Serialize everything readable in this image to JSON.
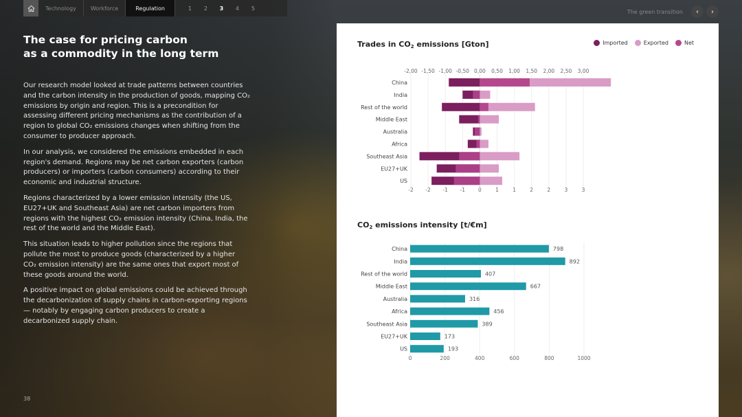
{
  "nav": {
    "items": [
      "Technology",
      "Workforce",
      "Regulation"
    ],
    "active_item": "Regulation",
    "pages": [
      "1",
      "2",
      "3",
      "4",
      "5"
    ],
    "active_page": "3",
    "section_label": "The green transition"
  },
  "left": {
    "title": "The case for pricing carbon\nas a commodity in the long term",
    "paragraphs": [
      "Our research model looked at trade patterns between countries and the carbon intensity in the production of goods, mapping CO₂ emissions by origin and region. This is a precondition for assessing different pricing mechanisms as the contribution of a region to global CO₂ emissions changes when shifting from the consumer to producer approach.",
      "In our analysis, we considered the emissions embedded in each region's demand. Regions may be net carbon exporters (carbon producers) or importers (carbon consumers) according to their economic and industrial structure.",
      "Regions characterized by a lower emission intensity (the US, EU27+UK and Southeast Asia) are net carbon importers from regions with the highest CO₂ emission intensity (China, India, the rest of the world and the Middle East).",
      "This situation leads to higher pollution since the regions that pollute the most to produce goods (characterized by a higher CO₂ emission intensity) are the same ones that export most of these goods around the world.",
      "A positive impact on global emissions could be achieved through the decarbonization of supply chains in carbon-exporting regions — notably by engaging carbon producers to create a decarbonized supply chain."
    ],
    "page_number": "38"
  },
  "chart_data": [
    {
      "type": "bar",
      "orientation": "horizontal-stacked",
      "title": "Trades in CO₂ emissions [Gton]",
      "categories": [
        "China",
        "India",
        "Rest of the world",
        "Middle East",
        "Australia",
        "Africa",
        "Southeast Asia",
        "EU27+UK",
        "US"
      ],
      "series": [
        {
          "name": "Imported",
          "color": "#7b1f5e",
          "values": [
            -0.9,
            -0.5,
            -1.1,
            -0.6,
            -0.2,
            -0.35,
            -1.75,
            -1.25,
            -1.4
          ]
        },
        {
          "name": "Exported",
          "color": "#d99cc6",
          "values": [
            2.35,
            0.3,
            1.35,
            0.55,
            0.05,
            0.25,
            1.15,
            0.55,
            0.65
          ]
        },
        {
          "name": "Net",
          "color": "#b5478f",
          "values": [
            1.45,
            -0.2,
            0.25,
            -0.05,
            -0.15,
            -0.1,
            -0.6,
            -0.7,
            -0.75
          ]
        }
      ],
      "xlim": [
        -2,
        3
      ],
      "top_ticks": [
        "-2,00",
        "-1,50",
        "-1,00",
        "-0,50",
        "0,00",
        "0,50",
        "1,00",
        "1,50",
        "2,00",
        "2,50",
        "3,00"
      ],
      "bottom_ticks": [
        "-2",
        "-2",
        "-1",
        "-1",
        "0",
        "1",
        "1",
        "2",
        "2",
        "3",
        "3"
      ],
      "legend_position": "top-right"
    },
    {
      "type": "bar",
      "orientation": "horizontal",
      "title": "CO₂ emissions intensity [t/€m]",
      "categories": [
        "China",
        "India",
        "Rest of the world",
        "Middle East",
        "Australia",
        "Africa",
        "Southeast Asia",
        "EU27+UK",
        "US"
      ],
      "values": [
        798,
        892,
        407,
        667,
        316,
        456,
        389,
        173,
        193
      ],
      "color": "#1f9aa6",
      "xlim": [
        0,
        1000
      ],
      "ticks": [
        "0",
        "200",
        "400",
        "600",
        "800",
        "1000"
      ]
    }
  ]
}
